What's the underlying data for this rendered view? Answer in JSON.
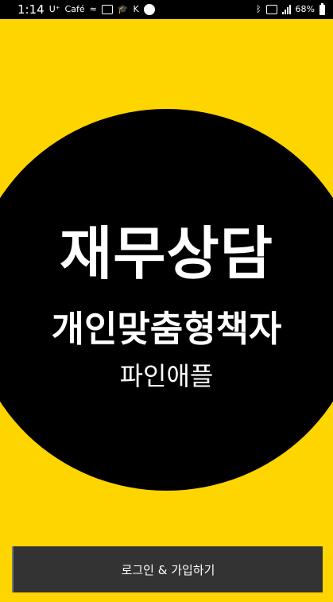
{
  "status_bar": {
    "time": "1:14",
    "battery_percent": "68%",
    "left_glyphs": [
      "U⁺",
      "Café",
      "≈",
      "▣",
      "🎓",
      "K",
      "Lock"
    ]
  },
  "title": {
    "main": "재무상담",
    "sub": "개인맞춤형책자",
    "brand": "파인애플"
  },
  "login": {
    "label": "로그인 & 가입하기"
  },
  "colors": {
    "background": "#FFD500",
    "circle": "#000000",
    "button": "#333333"
  }
}
